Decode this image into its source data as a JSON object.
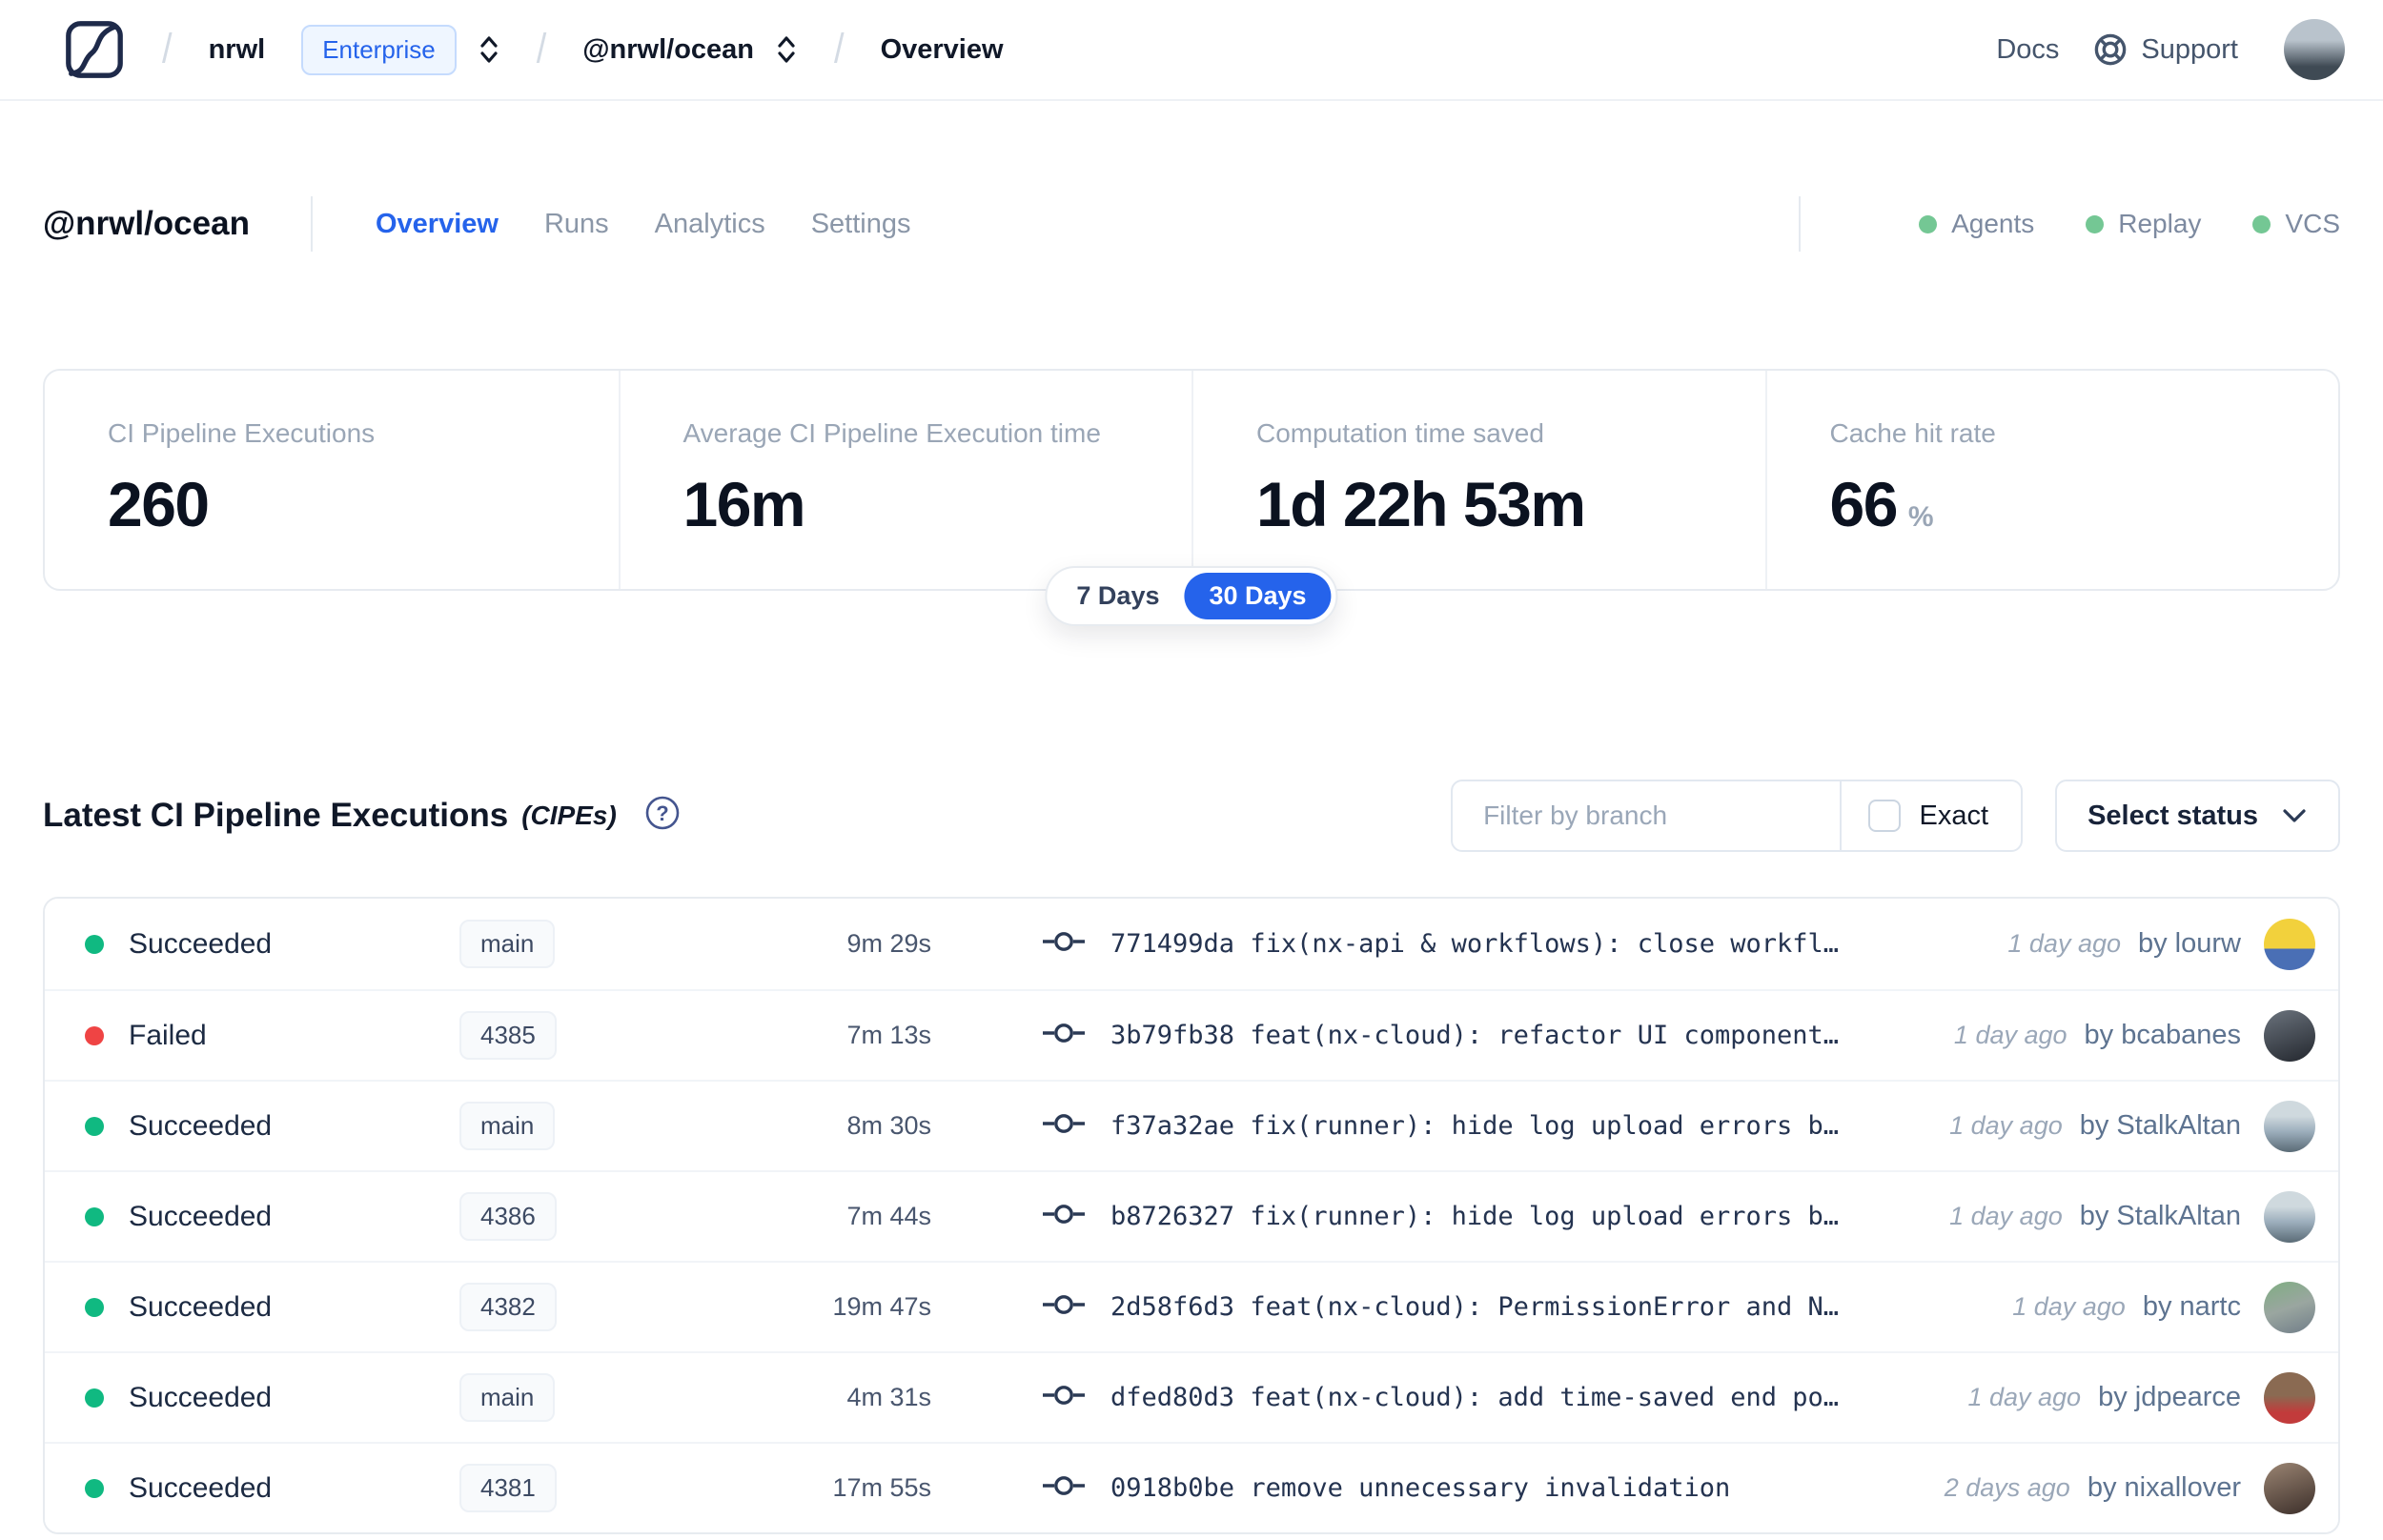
{
  "colors": {
    "accent_blue": "#2563eb",
    "success_green": "#10b981",
    "failed_red": "#ef4444",
    "header_dot_green": "#74c794",
    "enterprise_badge_bg": "#eff6ff"
  },
  "nav": {
    "separator": "/",
    "org": "nrwl",
    "org_badge": "Enterprise",
    "workspace": "@nrwl/ocean",
    "page": "Overview",
    "docs_label": "Docs",
    "support_label": "Support",
    "avatar_style": "background:linear-gradient(180deg,#b9c3cc 35%,#3f4a54 78%)"
  },
  "header": {
    "title": "@nrwl/ocean",
    "tabs": [
      {
        "label": "Overview"
      },
      {
        "label": "Runs"
      },
      {
        "label": "Analytics"
      },
      {
        "label": "Settings"
      }
    ],
    "statuses": [
      {
        "label": "Agents"
      },
      {
        "label": "Replay"
      },
      {
        "label": "VCS"
      }
    ]
  },
  "stats": {
    "cards": [
      {
        "label": "CI Pipeline Executions",
        "value": "260"
      },
      {
        "label": "Average CI Pipeline Execution time",
        "value": "16m"
      },
      {
        "label": "Computation time saved",
        "value": "1d 22h 53m"
      },
      {
        "label": "Cache hit rate",
        "value": "66",
        "suffix": "%"
      }
    ],
    "range": {
      "option_7": "7 Days",
      "option_30": "30 Days",
      "selected": "30 Days"
    }
  },
  "section": {
    "title": "Latest CI Pipeline Executions",
    "suffix": "(CIPEs)",
    "filter_placeholder": "Filter by branch",
    "exact_label": "Exact",
    "select_status_label": "Select status"
  },
  "table": {
    "rows": [
      {
        "status": "Succeeded",
        "dot_style": "background:#10b981",
        "branch": "main",
        "duration": "9m 29s",
        "commit_hash": "771499da",
        "commit_message": "fix(nx-api & workflows): close workfl…",
        "ago": "1 day ago",
        "author": "by lourw",
        "avatar_style": "background:linear-gradient(180deg,#f2d13c 58%,#4a6fb5 58%)"
      },
      {
        "status": "Failed",
        "dot_style": "background:#ef4444",
        "branch": "4385",
        "duration": "7m 13s",
        "commit_hash": "3b79fb38",
        "commit_message": "feat(nx-cloud): refactor UI component…",
        "ago": "1 day ago",
        "author": "by bcabanes",
        "avatar_style": "background:linear-gradient(160deg,#6b737d,#23272e)"
      },
      {
        "status": "Succeeded",
        "dot_style": "background:#10b981",
        "branch": "main",
        "duration": "8m 30s",
        "commit_hash": "f37a32ae",
        "commit_message": "fix(runner): hide log upload errors b…",
        "ago": "1 day ago",
        "author": "by StalkAltan",
        "avatar_style": "background:linear-gradient(180deg,#cfd9de 30%,#9caebc 60%,#5a6b76)"
      },
      {
        "status": "Succeeded",
        "dot_style": "background:#10b981",
        "branch": "4386",
        "duration": "7m 44s",
        "commit_hash": "b8726327",
        "commit_message": "fix(runner): hide log upload errors b…",
        "ago": "1 day ago",
        "author": "by StalkAltan",
        "avatar_style": "background:linear-gradient(180deg,#cfd9de 30%,#9caebc 60%,#5a6b76)"
      },
      {
        "status": "Succeeded",
        "dot_style": "background:#10b981",
        "branch": "4382",
        "duration": "19m 47s",
        "commit_hash": "2d58f6d3",
        "commit_message": "feat(nx-cloud): PermissionError and N…",
        "ago": "1 day ago",
        "author": "by nartc",
        "avatar_style": "background:linear-gradient(160deg,#7fae82,#9aa6a0 50%,#707d88)"
      },
      {
        "status": "Succeeded",
        "dot_style": "background:#10b981",
        "branch": "main",
        "duration": "4m 31s",
        "commit_hash": "dfed80d3",
        "commit_message": "feat(nx-cloud): add time-saved end po…",
        "ago": "1 day ago",
        "author": "by jdpearce",
        "avatar_style": "background:linear-gradient(180deg,#8a6a52 45%,#c23b3b 78%)"
      },
      {
        "status": "Succeeded",
        "dot_style": "background:#10b981",
        "branch": "4381",
        "duration": "17m 55s",
        "commit_hash": "0918b0be",
        "commit_message": "remove unnecessary invalidation",
        "ago": "2 days ago",
        "author": "by nixallover",
        "avatar_style": "background:linear-gradient(160deg,#9b8573,#3c2f2a)"
      }
    ]
  }
}
